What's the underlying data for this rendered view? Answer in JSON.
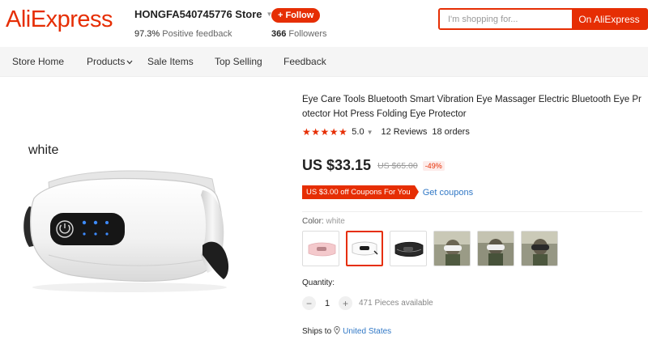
{
  "header": {
    "logo_text": "AliExpress",
    "store_name": "HONGFA540745776 Store",
    "feedback_percent": "97.3%",
    "feedback_label": "Positive feedback",
    "follow_label": "+ Follow",
    "followers_count": "366",
    "followers_label": "Followers",
    "search_placeholder": "I'm shopping for...",
    "search_button": "On AliExpress"
  },
  "nav": {
    "items": [
      {
        "label": "Store Home"
      },
      {
        "label": "Products",
        "icon": "chevron-down-icon"
      },
      {
        "label": "Sale Items"
      },
      {
        "label": "Top Selling"
      },
      {
        "label": "Feedback"
      }
    ]
  },
  "gallery": {
    "image_tag": "white"
  },
  "product": {
    "title": "Eye Care Tools Bluetooth Smart Vibration Eye Massager Electric Bluetooth Eye Protector Hot Press Folding Eye Protector",
    "rating_stars": 5,
    "rating": "5.0",
    "reviews": "12 Reviews",
    "orders": "18 orders",
    "price": "US $33.15",
    "old_price": "US $65.00",
    "discount": "-49%",
    "coupon_text": "US $3.00 off Coupons For You",
    "get_coupons": "Get coupons",
    "color_label": "Color:",
    "color_value": "white",
    "swatches": [
      {
        "name": "pink",
        "color": "#f4c9cc"
      },
      {
        "name": "white",
        "color": "#ffffff",
        "selected": true
      },
      {
        "name": "black",
        "color": "#222222"
      },
      {
        "name": "photo-1",
        "color": "#8a8c7a"
      },
      {
        "name": "photo-2",
        "color": "#8a8c7a"
      },
      {
        "name": "photo-3",
        "color": "#8a8c7a"
      }
    ],
    "quantity_label": "Quantity:",
    "quantity": "1",
    "available": "471 Pieces available",
    "ships_to_label": "Ships to",
    "ships_to": "United States"
  },
  "colors": {
    "accent": "#e62e04",
    "link": "#3178c6"
  }
}
